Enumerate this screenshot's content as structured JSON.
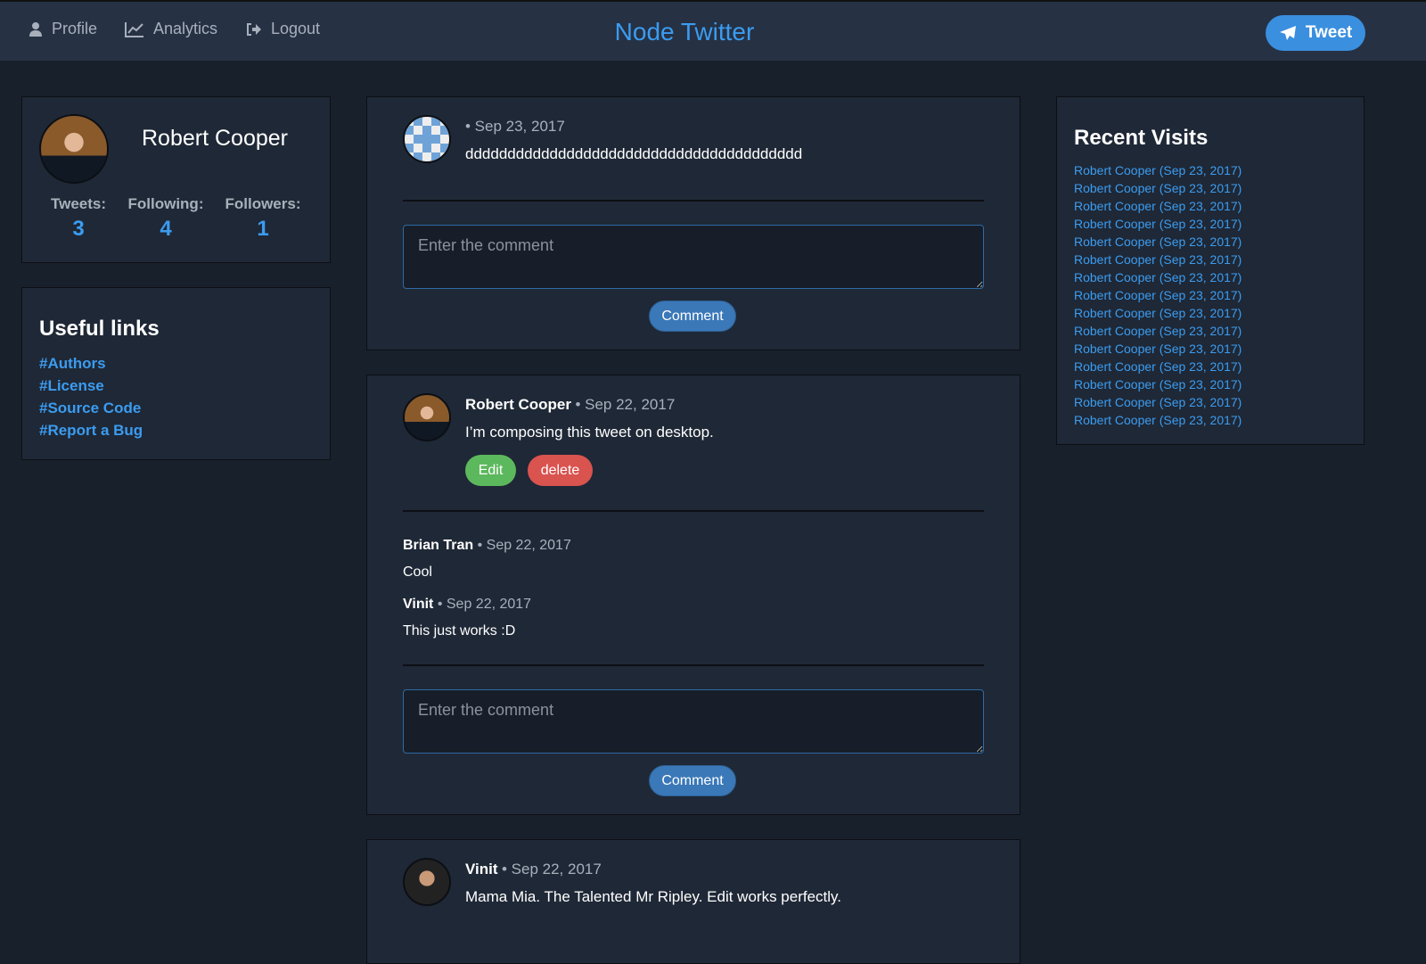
{
  "nav": {
    "profile": "Profile",
    "analytics": "Analytics",
    "logout": "Logout",
    "brand": "Node Twitter",
    "tweet": "Tweet"
  },
  "profile": {
    "name": "Robert Cooper",
    "stats": [
      {
        "label": "Tweets:",
        "value": "3"
      },
      {
        "label": "Following:",
        "value": "4"
      },
      {
        "label": "Followers:",
        "value": "1"
      }
    ]
  },
  "links": {
    "title": "Useful links",
    "items": [
      "#Authors",
      "#License",
      "#Source Code",
      "#Report a Bug"
    ]
  },
  "recent": {
    "title": "Recent Visits",
    "items": [
      "Robert Cooper (Sep 23, 2017)",
      "Robert Cooper (Sep 23, 2017)",
      "Robert Cooper (Sep 23, 2017)",
      "Robert Cooper (Sep 23, 2017)",
      "Robert Cooper (Sep 23, 2017)",
      "Robert Cooper (Sep 23, 2017)",
      "Robert Cooper (Sep 23, 2017)",
      "Robert Cooper (Sep 23, 2017)",
      "Robert Cooper (Sep 23, 2017)",
      "Robert Cooper (Sep 23, 2017)",
      "Robert Cooper (Sep 23, 2017)",
      "Robert Cooper (Sep 23, 2017)",
      "Robert Cooper (Sep 23, 2017)",
      "Robert Cooper (Sep 23, 2017)",
      "Robert Cooper (Sep 23, 2017)"
    ]
  },
  "tweets": [
    {
      "author": "",
      "date": "• Sep 23, 2017",
      "text": "dddddddddddddddddddddddddddddddddddddddd"
    },
    {
      "author": "Robert Cooper",
      "date": "• Sep 22, 2017",
      "text": "I’m composing this tweet on desktop.",
      "edit": "Edit",
      "delete": "delete",
      "comments": [
        {
          "author": "Brian Tran",
          "date": "• Sep 22, 2017",
          "text": "Cool"
        },
        {
          "author": "Vinit",
          "date": "• Sep 22, 2017",
          "text": "This just works :D"
        }
      ]
    },
    {
      "author": "Vinit",
      "date": "• Sep 22, 2017",
      "text": "Mama Mia. The Talented Mr Ripley. Edit works perfectly."
    }
  ],
  "comment_placeholder": "Enter the comment",
  "comment_button": "Comment"
}
